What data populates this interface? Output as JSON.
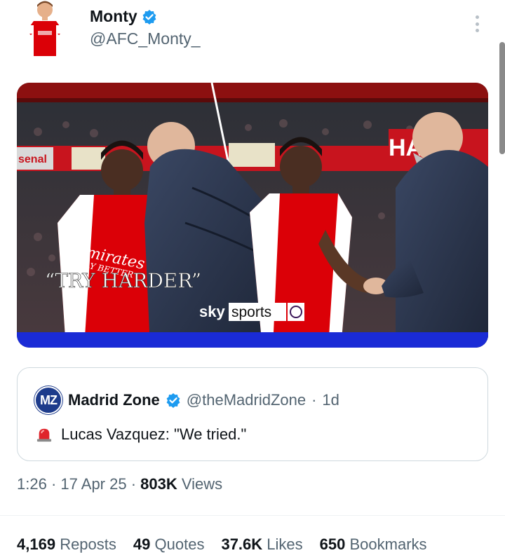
{
  "author": {
    "name": "Monty",
    "handle": "@AFC_Monty_",
    "verified": true
  },
  "media": {
    "caption": "“TRY HARDER”",
    "broadcaster_word1": "sky",
    "broadcaster_word2": "sports",
    "board_fragment_left": "senal",
    "board_fragment_right": "HA",
    "shirt_sponsor": "Emirates",
    "shirt_tagline": "FLY BETTER"
  },
  "quoted_post": {
    "avatar_text": "MZ",
    "name": "Madrid Zone",
    "handle": "@theMadridZone",
    "age": "1d",
    "separator": "·",
    "text": "Lucas Vazquez: \"We tried.\""
  },
  "post_meta": {
    "time": "1:26",
    "date": "17 Apr 25",
    "views_count": "803K",
    "views_label": "Views",
    "separator": "·"
  },
  "stats": [
    {
      "count": "4,169",
      "label": "Reposts"
    },
    {
      "count": "49",
      "label": "Quotes"
    },
    {
      "count": "37.6K",
      "label": "Likes"
    },
    {
      "count": "650",
      "label": "Bookmarks"
    }
  ],
  "colors": {
    "verified_badge": "#1d9bf0",
    "secondary_text": "#536471",
    "arsenal_red": "#db0007",
    "sky_blue": "#1a2bd6"
  },
  "icons": [
    "verified-badge-icon",
    "more-vertical-icon",
    "siren-icon"
  ]
}
